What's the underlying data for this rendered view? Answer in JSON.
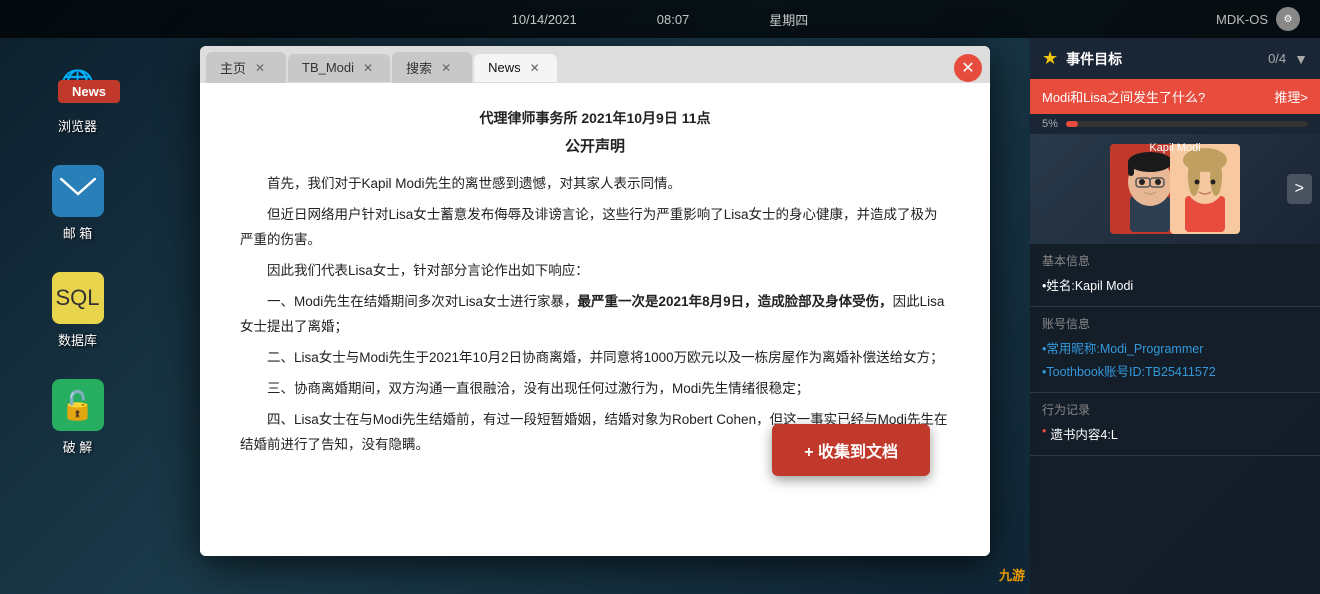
{
  "topbar": {
    "date": "10/14/2021",
    "time": "08:07",
    "day": "星期四",
    "os": "MDK-OS"
  },
  "desktop": {
    "icons": [
      {
        "id": "browser",
        "emoji": "🌐",
        "label": "浏览器"
      },
      {
        "id": "email",
        "emoji": "✉️",
        "label": "邮 箱"
      },
      {
        "id": "database",
        "emoji": "🗄️",
        "label": "数据库"
      },
      {
        "id": "crack",
        "emoji": "🔓",
        "label": "破 解"
      }
    ]
  },
  "news_badge": {
    "label": "News"
  },
  "browser": {
    "tabs": [
      {
        "id": "home",
        "label": "主页",
        "active": false
      },
      {
        "id": "tb_modi",
        "label": "TB_Modi",
        "active": false
      },
      {
        "id": "search",
        "label": "搜索",
        "active": false
      },
      {
        "id": "news",
        "label": "News",
        "active": true
      }
    ],
    "close_btn": "✕",
    "article": {
      "title_line1": "代理律师事务所 2021年10月9日 11点",
      "title_line2": "公开声明",
      "para1": "首先，我们对于Kapil Modi先生的离世感到遗憾，对其家人表示同情。",
      "para2": "但近日网络用户针对Lisa女士蓄意发布侮辱及诽谤言论，这些行为严重影响了Lisa女士的身心健康，并造成了极为严重的伤害。",
      "para3": "因此我们代表Lisa女士，针对部分言论作出如下响应：",
      "para4_prefix": "一、Modi先生在结婚期间多次对Lisa女士进行家暴，",
      "para4_bold": "最严重一次是2021年8月9日，造成脸部及身体受伤，",
      "para4_suffix": "因此Lisa女士提出了离婚；",
      "para5": "二、Lisa女士与Modi先生于2021年10月2日协商离婚，并同意将1000万欧元以及一栋房屋作为离婚补偿送给女方；",
      "para6": "三、协商离婚期间，双方沟通一直很融洽，没有出现任何过激行为，Modi先生情绪很稳定；",
      "para7": "四、Lisa女士在与Modi先生结婚前，有过一段短暂婚姻，结婚对象为Robert Cohen，但这一事实已经与Modi先生在结婚前进行了告知，没有隐瞒。"
    },
    "collect_btn": "+ 收集到文档"
  },
  "right_panel": {
    "event_header": {
      "title": "事件目标",
      "count": "0/4",
      "star": "★"
    },
    "event_question": {
      "text": "Modi和Lisa之间发生了什么?",
      "action": "推理>"
    },
    "progress": {
      "value": 5,
      "label": "5%"
    },
    "profile": {
      "label": "Kapil Modi",
      "nav_btn": ">"
    },
    "basic_info": {
      "section_title": "基本信息",
      "name_label": "•姓名:Kapil Modi"
    },
    "account_info": {
      "section_title": "账号信息",
      "nickname_label": "•常用昵称:Modi_Programmer",
      "toothbook_label": "•Toothbook账号ID:TB25411572"
    },
    "behavior": {
      "section_title": "行为记录",
      "item1": "遗书内容4:L"
    }
  },
  "jiuyou": {
    "label": "九游"
  }
}
